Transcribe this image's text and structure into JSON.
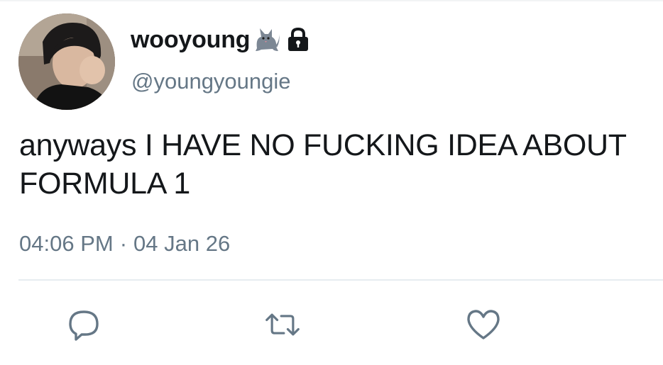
{
  "tweet": {
    "display_name": "wooyoung",
    "name_emoji": "cat-emoji",
    "protected_icon": "lock-icon",
    "handle": "@youngyoungie",
    "text": "anyways I HAVE NO FUCKING IDEA ABOUT FORMULA 1",
    "time": "04:06 PM",
    "separator": "·",
    "date": "04 Jan 26"
  },
  "actions": {
    "reply_icon": "reply-icon",
    "retweet_icon": "retweet-icon",
    "like_icon": "heart-icon"
  },
  "colors": {
    "text": "#14171a",
    "secondary": "#657786",
    "divider": "#e6ecf0"
  }
}
